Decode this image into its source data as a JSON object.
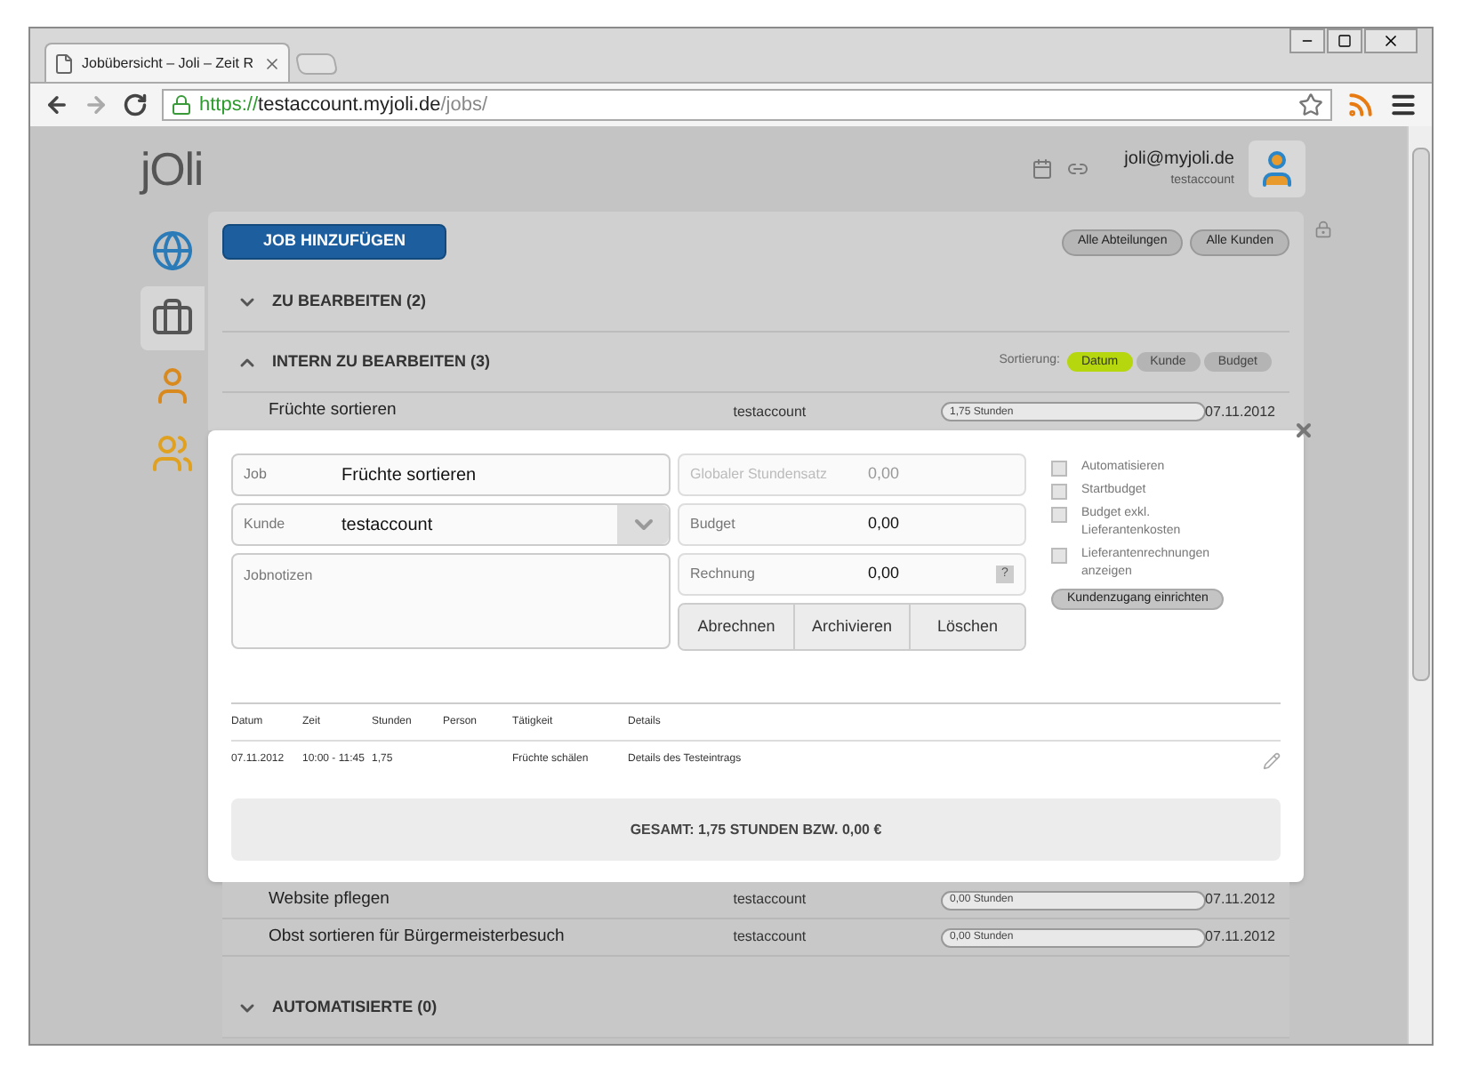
{
  "browser": {
    "tab_title": "Jobübersicht – Joli – Zeit R",
    "url": {
      "scheme": "https://",
      "host": "testaccount.myjoli.de",
      "path": "/jobs/"
    }
  },
  "header": {
    "logo": "jOli",
    "user_email": "joli@myjoli.de",
    "account": "testaccount"
  },
  "sidebar": {
    "items": [
      {
        "selected": false
      },
      {
        "selected": true
      },
      {
        "selected": false
      },
      {
        "selected": false
      }
    ]
  },
  "toolbar": {
    "add_button": "JOB HINZUFÜGEN",
    "filters": [
      "Alle Abteilungen",
      "Alle Kunden"
    ]
  },
  "sections_top": [
    {
      "title": "ZU BEARBEITEN (2)",
      "expanded": false
    }
  ],
  "intern": {
    "title": "INTERN ZU BEARBEITEN (3)",
    "expanded": true,
    "sort_label": "Sortierung:",
    "sort_options": [
      {
        "label": "Datum",
        "selected": true
      },
      {
        "label": "Kunde",
        "selected": false
      },
      {
        "label": "Budget",
        "selected": false
      }
    ],
    "jobs_before": [
      {
        "name": "Früchte sortieren",
        "customer": "testaccount",
        "hours": "1,75 Stunden",
        "date": "07.11.2012"
      }
    ],
    "jobs_after": [
      {
        "name": "Website pflegen",
        "customer": "testaccount",
        "hours": "0,00 Stunden",
        "date": "07.11.2012"
      },
      {
        "name": "Obst sortieren für Bürgermeisterbesuch",
        "customer": "testaccount",
        "hours": "0,00 Stunden",
        "date": "07.11.2012"
      }
    ]
  },
  "detail": {
    "job_label": "Job",
    "job_value": "Früchte sortieren",
    "customer_label": "Kunde",
    "customer_value": "testaccount",
    "notes_placeholder": "Jobnotizen",
    "rate_label": "Globaler Stundensatz",
    "rate_value": "0,00",
    "budget_label": "Budget",
    "budget_value": "0,00",
    "invoice_label": "Rechnung",
    "invoice_value": "0,00",
    "invoice_help": "?",
    "actions": [
      "Abrechnen",
      "Archivieren",
      "Löschen"
    ],
    "options": [
      {
        "label": "Automatisieren",
        "checked": false
      },
      {
        "label": "Startbudget",
        "checked": false
      },
      {
        "label": "Budget exkl. Lieferantenkosten",
        "checked": false
      },
      {
        "label": "Lieferantenrechnungen anzeigen",
        "checked": false
      }
    ],
    "client_access_button": "Kundenzugang einrichten",
    "table": {
      "columns": [
        "Datum",
        "Zeit",
        "Stunden",
        "Person",
        "Tätigkeit",
        "Details"
      ],
      "rows": [
        [
          "07.11.2012",
          "10:00 - 11:45",
          "1,75",
          "",
          "Früchte schälen",
          "Details des Testeintrags"
        ]
      ]
    },
    "total": "GESAMT: 1,75 STUNDEN BZW. 0,00 €"
  },
  "sections_bottom": [
    {
      "title": "AUTOMATISIERTE (0)",
      "expanded": false
    }
  ]
}
